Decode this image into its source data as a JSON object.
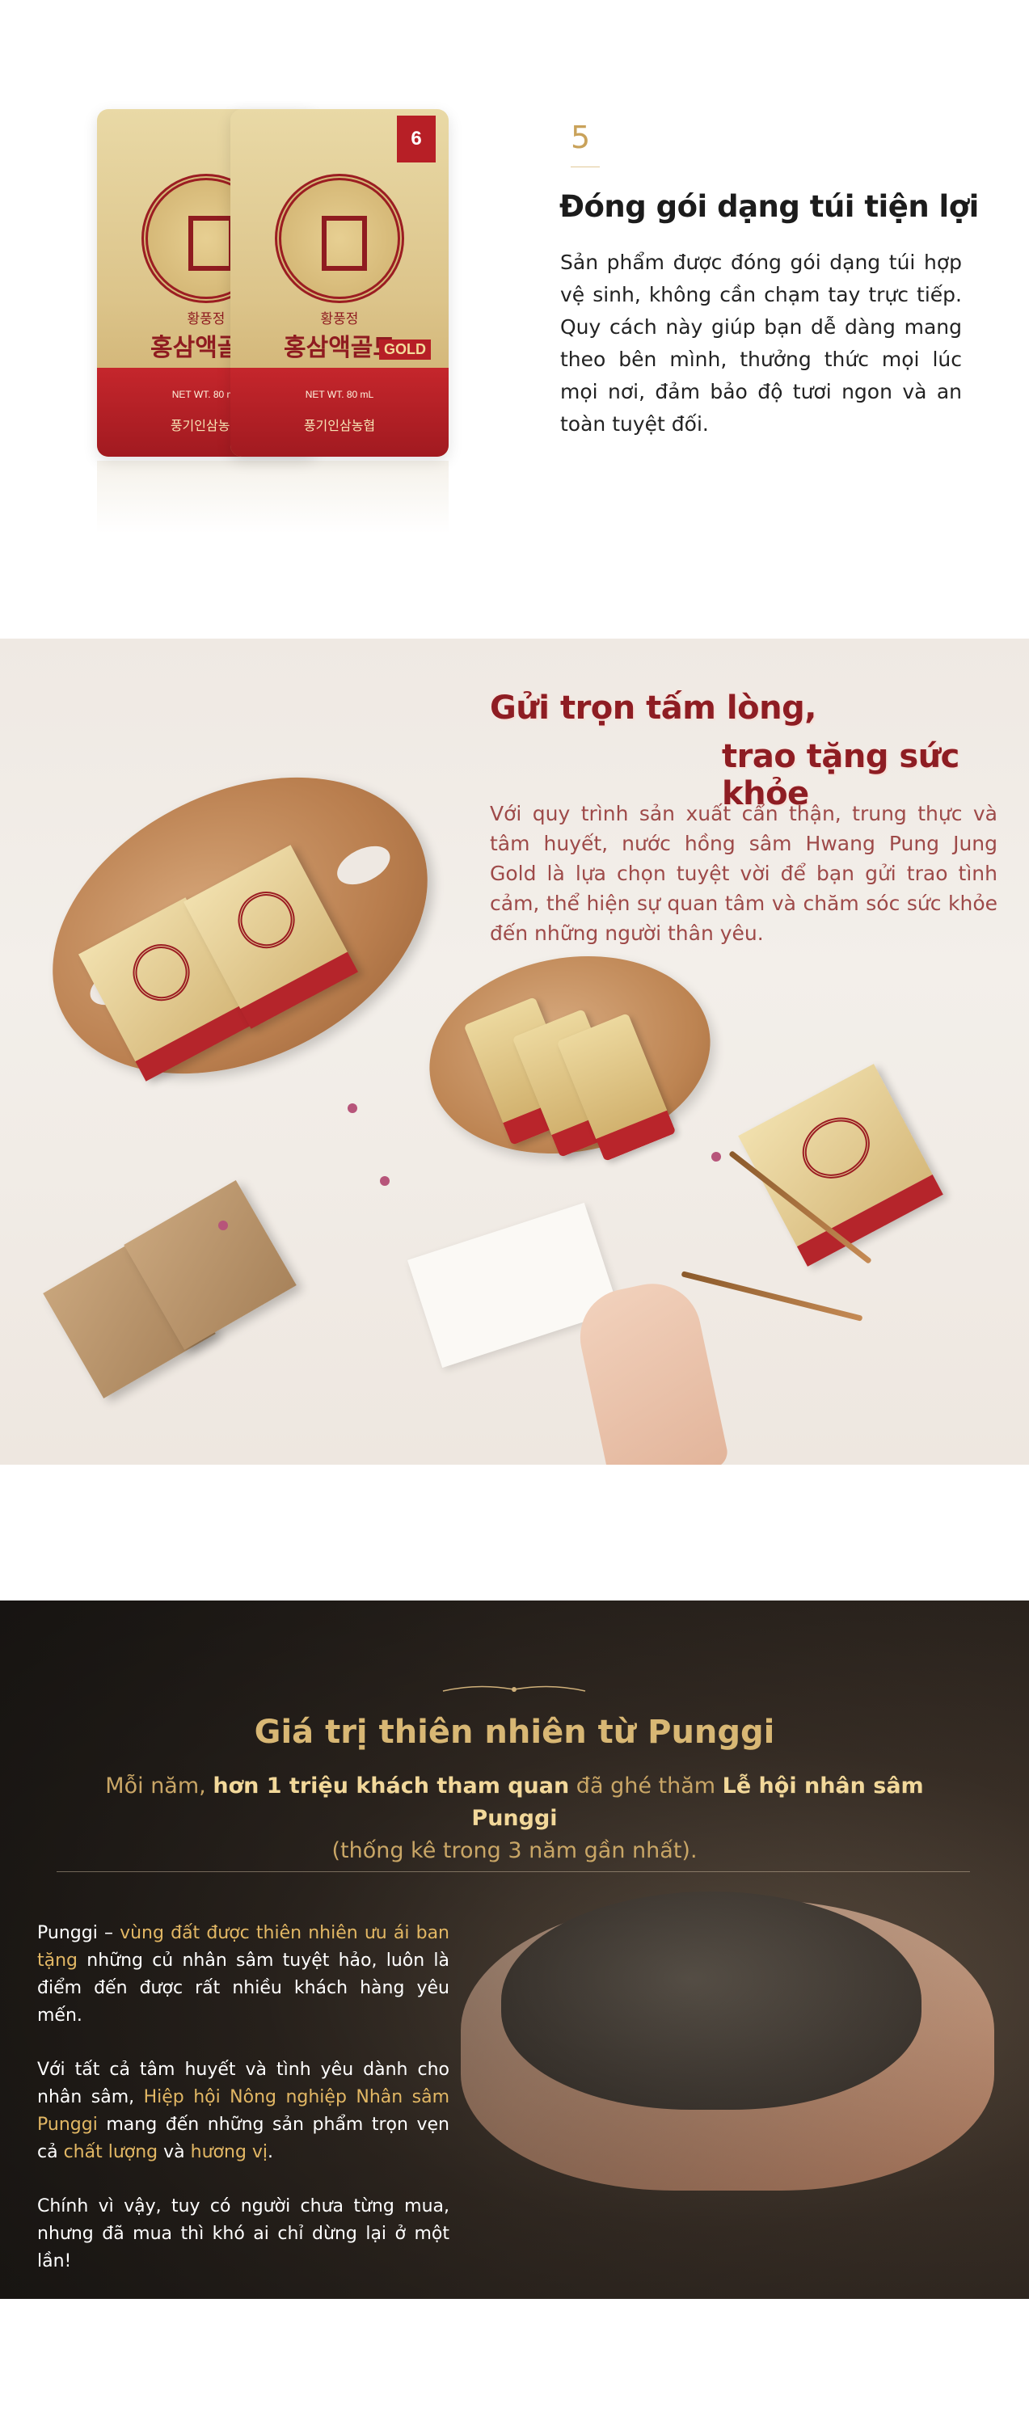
{
  "pouch_section": {
    "step_number": "5",
    "title": "Đóng gói dạng túi tiện lợi",
    "description": "Sản phẩm được đóng gói dạng túi hợp vệ sinh, không cần chạm tay trực tiếp. Quy cách này giúp bạn dễ dàng mang theo bên mình, thưởng thức mọi lúc mọi nơi, đảm bảo độ tươi ngon và an toàn tuyệt đối.",
    "product_image": {
      "age_tag": "6",
      "name_small": "황풍정",
      "name_large": "홍삼액골드",
      "gold_label": "GOLD",
      "net_weight": "NET WT. 80 mL",
      "brand": "풍기인삼농협"
    }
  },
  "gift_section": {
    "title_line_1": "Gửi trọn tấm lòng,",
    "title_line_2": "trao tặng sức khỏe",
    "description": "Với quy trình sản xuất cẩn thận, trung thực và tâm huyết, nước hồng sâm Hwang Pung Jung Gold là lựa chọn tuyệt vời để bạn gửi trao tình cảm, thể hiện sự quan tâm và chăm sóc sức khỏe đến những người thân yêu."
  },
  "punggi_section": {
    "title": "Giá trị thiên nhiên từ Punggi",
    "subtitle": {
      "part1": "Mỗi năm, ",
      "bold1": "hơn 1 triệu khách tham quan",
      "part2": " đã ghé thăm ",
      "bold2": "Lễ hội nhân sâm Punggi",
      "line2": "(thống kê trong 3 năm gần nhất)."
    },
    "paragraph1": {
      "text1": "Punggi – ",
      "gold1": "vùng đất được thiên nhiên ưu ái ban tặng",
      "text2": " những củ nhân sâm tuyệt hảo, luôn là điểm đến được rất nhiều khách hàng yêu mến."
    },
    "paragraph2": {
      "text1": "Với tất cả tâm huyết và tình yêu dành cho nhân sâm, ",
      "gold1": "Hiệp hội Nông nghiệp Nhân sâm Punggi",
      "text2": " mang đến những sản phẩm trọn vẹn cả ",
      "gold2": "chất lượng",
      "text3": " và ",
      "gold3": "hương vị",
      "text4": "."
    },
    "paragraph3": "Chính vì vậy, tuy có người chưa từng mua, nhưng đã mua thì khó ai chỉ dừng lại ở một lần!"
  }
}
